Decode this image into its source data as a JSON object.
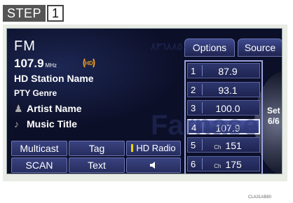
{
  "step": {
    "label": "STEP",
    "number": "1"
  },
  "now_playing": {
    "band": "FM",
    "frequency": "107.9",
    "frequency_unit": "MHz",
    "station_name": "HD Station Name",
    "pty": "PTY Genre",
    "artist": "Artist Name",
    "title": "Music Title"
  },
  "top_buttons": {
    "options": "Options",
    "source": "Source"
  },
  "controls": {
    "multicast": "Multicast",
    "tag": "Tag",
    "hd_radio": "HD Radio",
    "scan": "SCAN",
    "text": "Text"
  },
  "presets": [
    {
      "num": "1",
      "prefix": "",
      "value": "87.9"
    },
    {
      "num": "2",
      "prefix": "",
      "value": "93.1"
    },
    {
      "num": "3",
      "prefix": "",
      "value": "100.0"
    },
    {
      "num": "4",
      "prefix": "",
      "value": "107.9"
    },
    {
      "num": "5",
      "prefix": "Ch",
      "value": "151"
    },
    {
      "num": "6",
      "prefix": "Ch",
      "value": "175"
    }
  ],
  "set_display": {
    "label": "Set",
    "page": "6/6"
  },
  "watermark": {
    "text": "Farnase",
    "digits": "٠٢١-٨٣٦٨٨٥٠٠"
  },
  "image_code": "CLA31AB80",
  "colors": {
    "screen_bg": "#0c0f28",
    "hd_radio_indicator": "#e8d800",
    "hd_icon": "#e89a2a"
  }
}
